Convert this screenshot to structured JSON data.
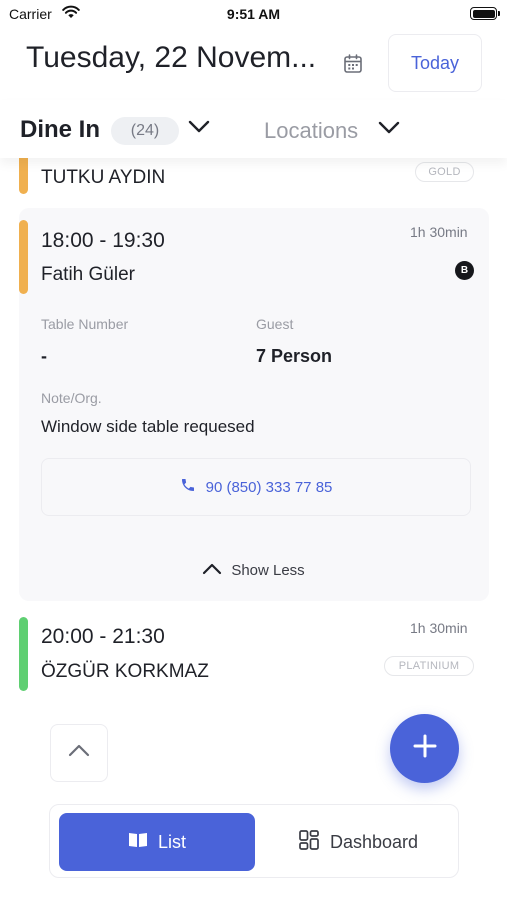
{
  "status_bar": {
    "carrier": "Carrier",
    "time": "9:51 AM"
  },
  "header": {
    "date_title": "Tuesday, 22 Novem...",
    "today_label": "Today"
  },
  "filters": {
    "dine_in_label": "Dine In",
    "dine_in_count": "(24)",
    "locations_label": "Locations"
  },
  "reservations": [
    {
      "name": "TUTKU AYDIN",
      "tier": "GOLD",
      "accent_color": "#f0b04f"
    },
    {
      "time": "18:00 - 19:30",
      "name": "Fatih Güler",
      "duration": "1h 30min",
      "badge": "B",
      "accent_color": "#f0b04f",
      "table_number_label": "Table Number",
      "table_number": "-",
      "guest_label": "Guest",
      "guest": "7 Person",
      "note_label": "Note/Org.",
      "note": "Window side table requesed",
      "phone": "90 (850) 333 77 85",
      "show_less_label": "Show Less"
    },
    {
      "time": "20:00 - 21:30",
      "name": "ÖZGÜR KORKMAZ",
      "duration": "1h 30min",
      "tier": "PLATINIUM",
      "accent_color": "#5fcf72"
    }
  ],
  "bottom_nav": {
    "list_label": "List",
    "dashboard_label": "Dashboard"
  },
  "icons": {
    "wifi": "wifi-icon",
    "battery": "battery-icon",
    "calendar": "calendar-icon",
    "chevron": "chevron-down-icon",
    "phone": "phone-icon",
    "chevron_up": "chevron-up-icon",
    "plus": "plus-icon",
    "book": "book-icon",
    "dashboard": "dashboard-icon"
  },
  "colors": {
    "accent": "#4a63d9",
    "gold": "#f0b04f",
    "green": "#5fcf72"
  }
}
